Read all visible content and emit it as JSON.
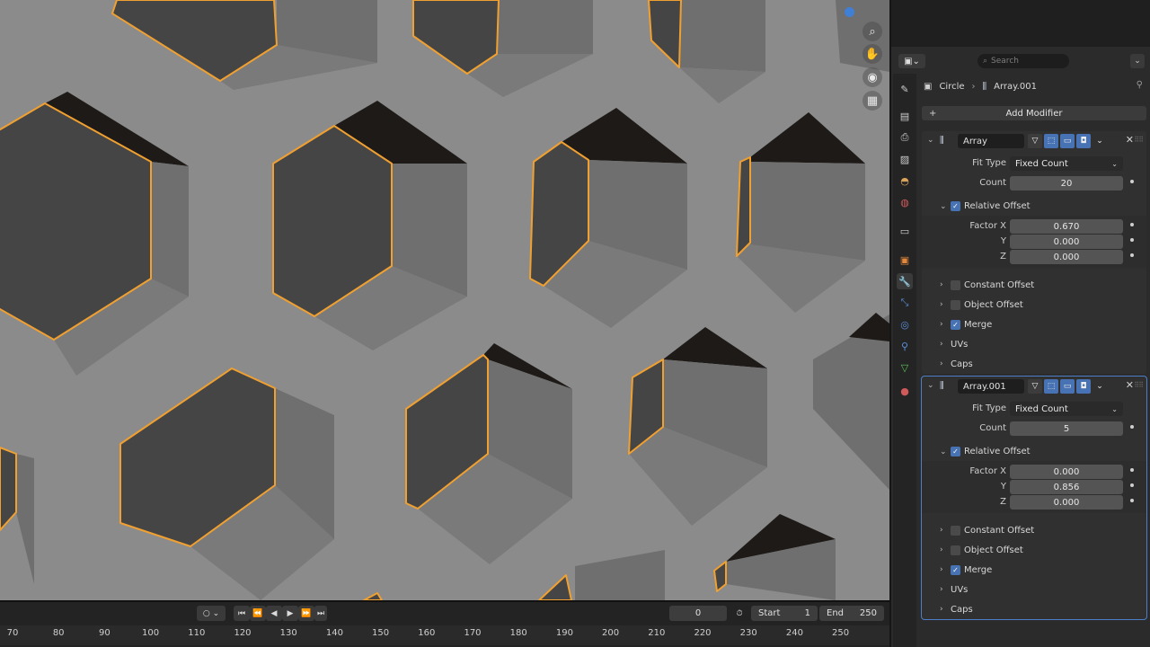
{
  "viewport": {
    "gizmos": [
      "zoom-icon",
      "hand-pan-icon",
      "camera-icon",
      "grid-perspective-icon"
    ]
  },
  "timeline": {
    "current_frame": "0",
    "start_label": "Start",
    "start_value": "1",
    "end_label": "End",
    "end_value": "250",
    "ticks": [
      "70",
      "80",
      "90",
      "100",
      "110",
      "120",
      "130",
      "140",
      "150",
      "160",
      "170",
      "180",
      "190",
      "200",
      "210",
      "220",
      "230",
      "240",
      "250"
    ]
  },
  "properties": {
    "search_placeholder": "Search",
    "breadcrumb": {
      "object": "Circle",
      "modifier": "Array.001"
    },
    "add_modifier_label": "Add Modifier",
    "modifiers": [
      {
        "name": "Array",
        "fit_type_label": "Fit Type",
        "fit_type": "Fixed Count",
        "count_label": "Count",
        "count": "20",
        "relative_offset_label": "Relative Offset",
        "factor_x_label": "Factor X",
        "factor_x": "0.670",
        "y_label": "Y",
        "y": "0.000",
        "z_label": "Z",
        "z": "0.000",
        "constant_offset_label": "Constant Offset",
        "object_offset_label": "Object Offset",
        "merge_label": "Merge",
        "uvs_label": "UVs",
        "caps_label": "Caps"
      },
      {
        "name": "Array.001",
        "fit_type_label": "Fit Type",
        "fit_type": "Fixed Count",
        "count_label": "Count",
        "count": "5",
        "relative_offset_label": "Relative Offset",
        "factor_x_label": "Factor X",
        "factor_x": "0.000",
        "y_label": "Y",
        "y": "0.856",
        "z_label": "Z",
        "z": "0.000",
        "constant_offset_label": "Constant Offset",
        "object_offset_label": "Object Offset",
        "merge_label": "Merge",
        "uvs_label": "UVs",
        "caps_label": "Caps"
      }
    ]
  },
  "colors": {
    "selection_outline": "#f0a030",
    "accent_blue": "#4772b3",
    "mesh_face": "#8a8a8a"
  }
}
